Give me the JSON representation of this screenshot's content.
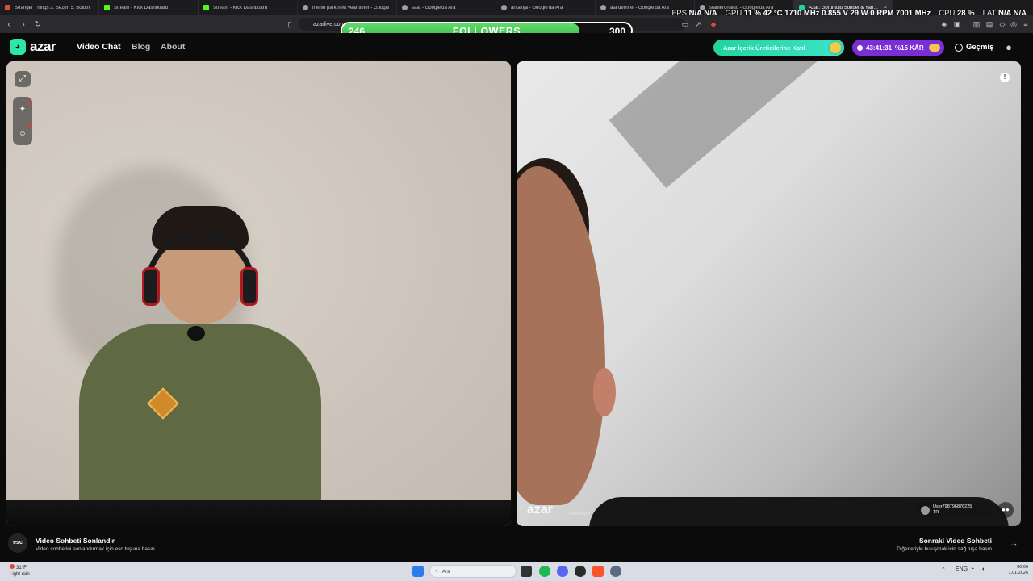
{
  "browser": {
    "tabs": [
      {
        "title": "Stranger Things 2: Sezon 5. Bölüm",
        "favicon": "square-red-icon"
      },
      {
        "title": "Stream - Kick Dashboard",
        "favicon": "kick-icon"
      },
      {
        "title": "Stream - Kick Dashboard",
        "favicon": "kick-icon"
      },
      {
        "title": "menlo park new year timer - Google",
        "favicon": "google-icon"
      },
      {
        "title": "saat - Google'da Ara",
        "favicon": "google-icon"
      },
      {
        "title": "antakya - Google'da Ara",
        "favicon": "google-icon"
      },
      {
        "title": "ata demirel - Google'da Ara",
        "favicon": "google-icon"
      },
      {
        "title": "stableronaldo - Google'da Ara",
        "favicon": "google-icon"
      },
      {
        "title": "Azar: Görüntülü Sohbet & Yabancı",
        "favicon": "azar-icon",
        "active": true,
        "close": "×"
      }
    ],
    "url": "azarlive.com"
  },
  "overlay": {
    "stats": [
      {
        "key": "FPS",
        "value": "N/A N/A"
      },
      {
        "key": "GPU",
        "value": "11 % 42 °C 1710 MHz 0.855 V 29 W 0 RPM 7001 MHz"
      },
      {
        "key": "CPU",
        "value": "28 %"
      },
      {
        "key": "LAT",
        "value": "N/A N/A"
      }
    ],
    "followers": {
      "current": "246",
      "label": "FOLLOWERS",
      "goal": "300",
      "progress": 0.82
    }
  },
  "azar": {
    "brand": "azar",
    "nav": [
      {
        "label": "Video Chat",
        "active": true
      },
      {
        "label": "Blog",
        "active": false
      },
      {
        "label": "About",
        "active": false
      }
    ],
    "creator_button": "Azar İçerik Üreticilerine Katıl",
    "timer": {
      "time": "43:41:31",
      "profit": "%15 KÂR"
    },
    "history_label": "Geçmiş",
    "colors": {
      "accent": "#2ee6a8",
      "purple": "#7b2ed6"
    }
  },
  "remote": {
    "watermark": "azar",
    "watermark_id": "7-MAPieqTp",
    "user_name": "User798796876225",
    "user_country": "TR"
  },
  "footer": {
    "esc_key": "esc",
    "end_title": "Video Sohbeti Sonlandır",
    "end_sub": "Video sohbetini sonlandırmak için esc tuşuna basın.",
    "next_title": "Sonraki Video Sohbeti",
    "next_sub": "Diğerleriyle buluşmak için sağ tuşa basın"
  },
  "taskbar": {
    "weather_temp": "31°F",
    "weather_desc": "Light rain",
    "search_placeholder": "Ara",
    "lang": "ENG",
    "time": "00:06",
    "date": "1.01.2026"
  }
}
